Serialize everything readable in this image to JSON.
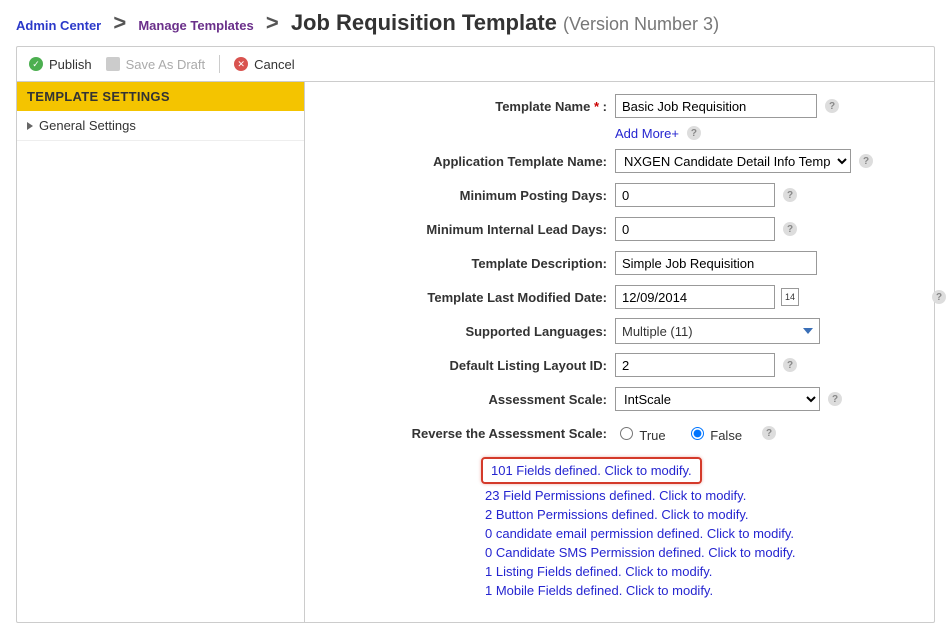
{
  "breadcrumb": {
    "admin": "Admin Center",
    "templates": "Manage Templates",
    "page": "Job Requisition Template",
    "version": "(Version Number 3)"
  },
  "toolbar": {
    "publish": "Publish",
    "save_draft": "Save As Draft",
    "cancel": "Cancel"
  },
  "sidebar": {
    "header": "TEMPLATE SETTINGS",
    "items": [
      "General Settings"
    ]
  },
  "form": {
    "template_name_label": "Template Name",
    "template_name_value": "Basic Job Requisition",
    "add_more": "Add More+",
    "app_template_label": "Application Template Name:",
    "app_template_value": "NXGEN Candidate Detail Info Template",
    "min_posting_label": "Minimum Posting Days:",
    "min_posting_value": "0",
    "min_internal_label": "Minimum Internal Lead Days:",
    "min_internal_value": "0",
    "desc_label": "Template Description:",
    "desc_value": "Simple Job Requisition",
    "mod_date_label": "Template Last Modified Date:",
    "mod_date_value": "12/09/2014",
    "cal_text": "14",
    "langs_label": "Supported Languages:",
    "langs_value": "Multiple (11)",
    "layout_label": "Default Listing Layout ID:",
    "layout_value": "2",
    "scale_label": "Assessment Scale:",
    "scale_value": "IntScale",
    "reverse_label": "Reverse the Assessment Scale:",
    "reverse_true": "True",
    "reverse_false": "False"
  },
  "links": {
    "fields": "101 Fields defined. Click to modify.",
    "field_perms": "23 Field Permissions defined. Click to modify.",
    "button_perms": "2 Button Permissions defined. Click to modify.",
    "cand_email": "0 candidate email permission defined. Click to modify.",
    "cand_sms": "0 Candidate SMS Permission defined. Click to modify.",
    "listing_fields": "1 Listing Fields defined. Click to modify.",
    "mobile_fields": "1 Mobile Fields defined. Click to modify."
  }
}
